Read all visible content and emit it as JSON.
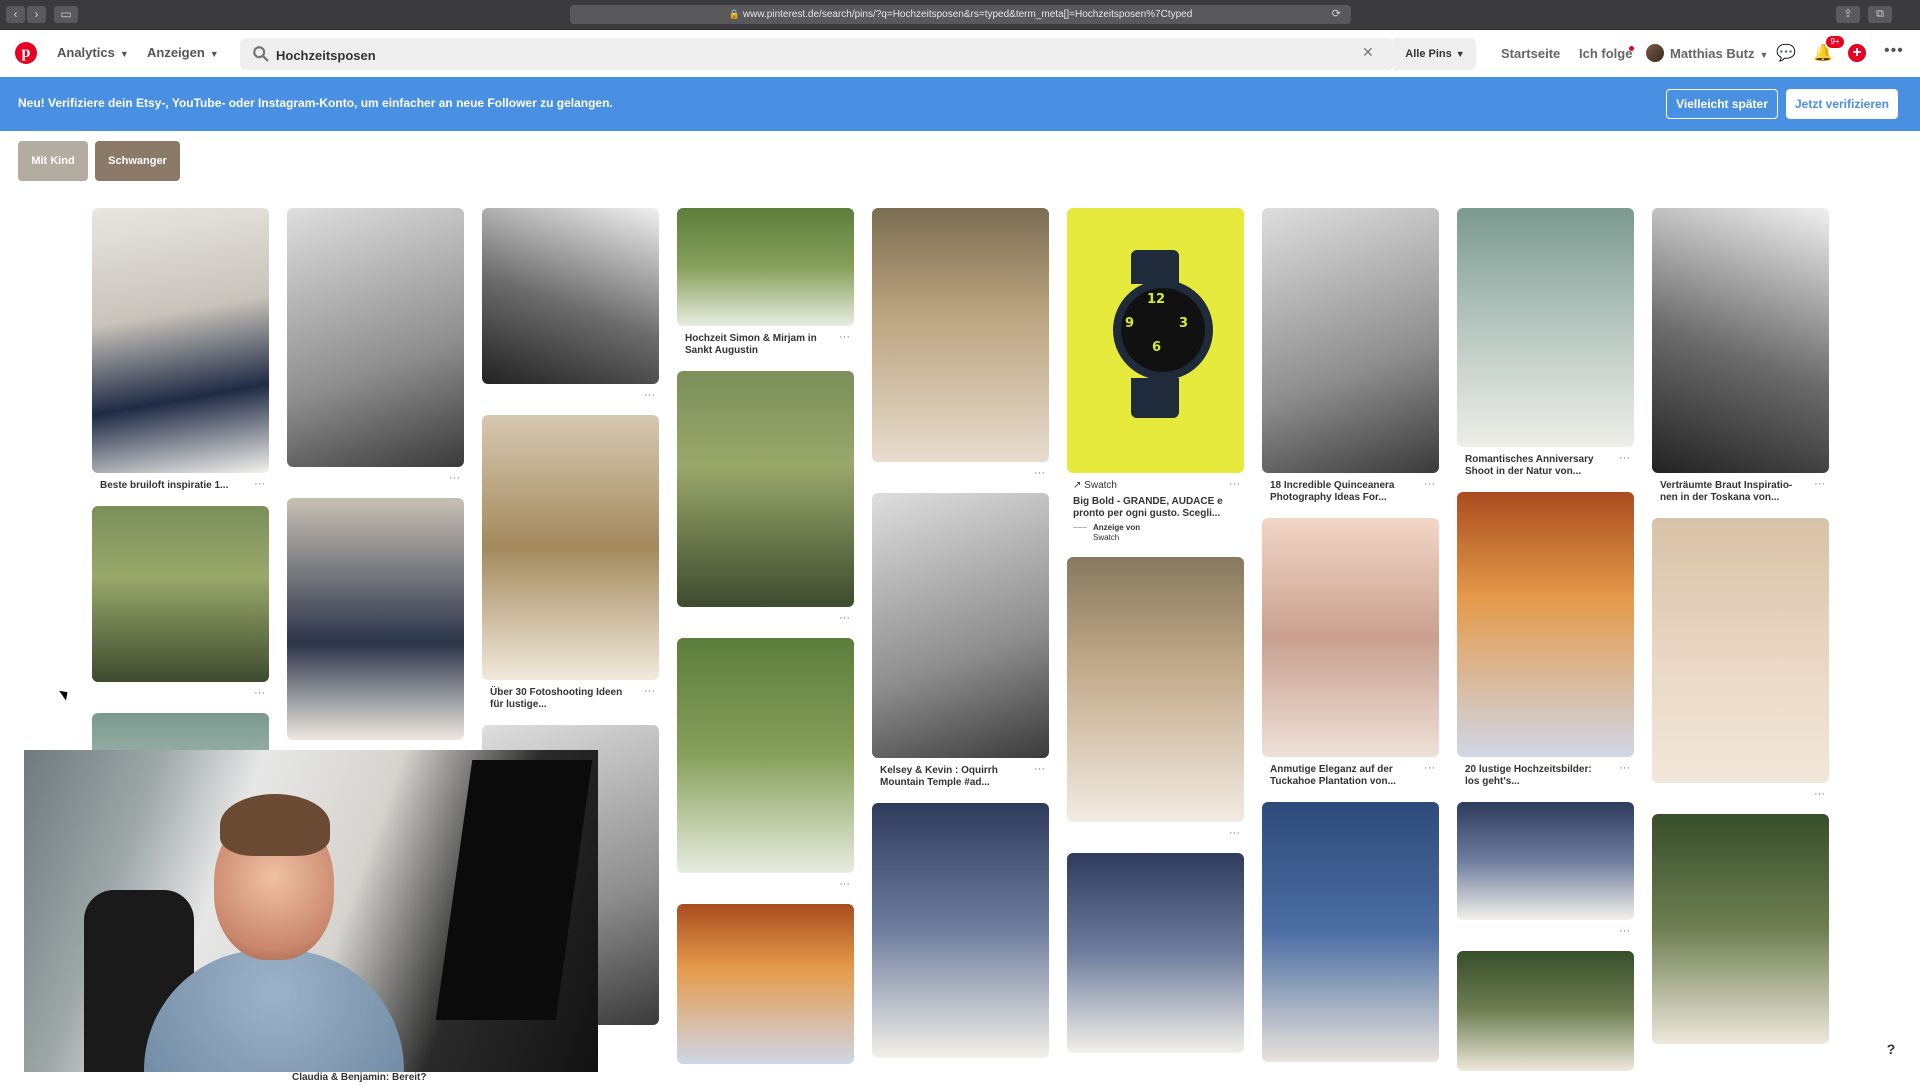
{
  "browser": {
    "url": "www.pinterest.de/search/pins/?q=Hochzeitsposen&rs=typed&term_meta[]=Hochzeitsposen%7Ctyped"
  },
  "header": {
    "nav": [
      {
        "label": "Analytics"
      },
      {
        "label": "Anzeigen"
      }
    ],
    "search": {
      "value": "Hochzeitsposen"
    },
    "scope": "Alle Pins",
    "links": [
      "Startseite",
      "Ich folge"
    ],
    "user": "Matthias Butz",
    "notif_badge": "9+"
  },
  "banner": {
    "message": "Neu! Verifiziere dein Etsy-, YouTube- oder Instagram-Konto, um einfacher an neue Follower zu gelangen.",
    "later": "Vielleicht später",
    "verify": "Jetzt verifizieren"
  },
  "filters": [
    {
      "label": "Mit Kind",
      "color": "#b3aca0"
    },
    {
      "label": "Schwanger",
      "color": "#8a7a67"
    }
  ],
  "pins": {
    "c1": [
      "Beste bruiloft inspiratie 1...",
      "",
      ""
    ],
    "c3": [
      "",
      "Über 30 Fotoshooting Ideen für lustige..."
    ],
    "c4": [
      "Hochzeit Simon & Mirjam in Sankt Augustin",
      "",
      ""
    ],
    "c5": [
      "",
      "Kelsey & Kevin : Oquirrh Mountain Temple #ad...",
      ""
    ],
    "c6": {
      "brand": "Swatch",
      "title": "Big Bold - GRANDE, AUDACE e pronto per ogni gusto. Scegli...",
      "promo_label": "Anzeige von",
      "promo_brand": "Swatch"
    },
    "c7": [
      "18 Incredible Quinceanera Photography Ideas For...",
      "Anmutige Eleganz auf der Tuckahoe Plantation von...",
      ""
    ],
    "c8": [
      "Romantisches Anniversary Shoot in der Natur von...",
      "20 lustige Hochzeitsbilder: los geht's...",
      "",
      ""
    ],
    "c9": [
      "Verträumte Braut Inspiratio-nen in der Toskana von...",
      "",
      ""
    ],
    "cam_peek_title": "Claudia & Benjamin: Bereit?"
  },
  "help": "?",
  "icons": {
    "back": "chevron-left-icon",
    "forward": "chevron-right-icon",
    "search": "magnifier-icon",
    "clear": "x-icon",
    "messages": "speech-bubble-icon",
    "notifications": "bell-icon",
    "add": "plus-icon",
    "more": "ellipsis-icon"
  },
  "colors": {
    "brand": "#e60023",
    "banner": "#4a90e2"
  }
}
